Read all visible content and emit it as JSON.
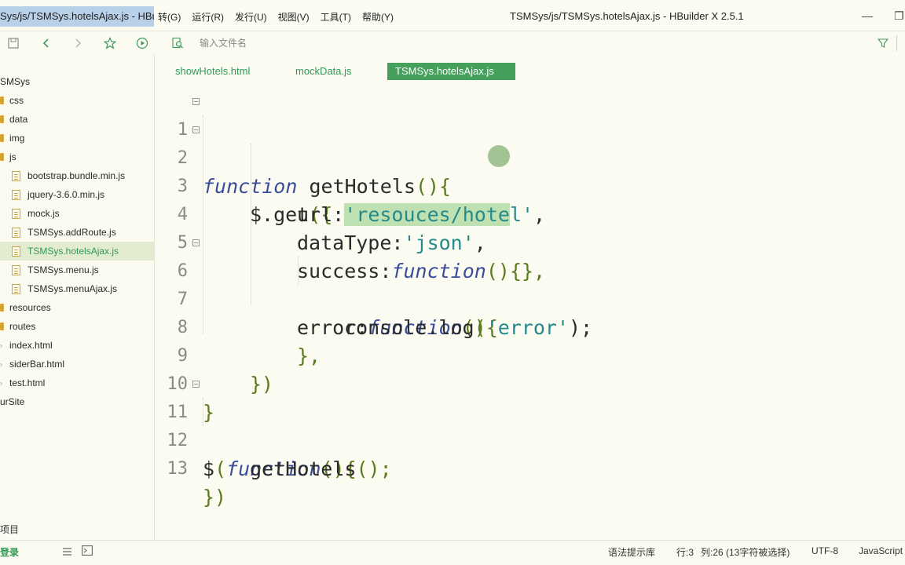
{
  "window": {
    "tab_title": "Sys/js/TSMSys.hotelsAjax.js - HBuil",
    "title": "TSMSys/js/TSMSys.hotelsAjax.js - HBuilder X 2.5.1",
    "minimize_glyph": "—",
    "restore_glyph": "❐"
  },
  "menu": [
    {
      "label": "转(G)"
    },
    {
      "label": "运行(R)"
    },
    {
      "label": "发行(U)"
    },
    {
      "label": "视图(V)"
    },
    {
      "label": "工具(T)"
    },
    {
      "label": "帮助(Y)"
    }
  ],
  "toolbar": {
    "search_placeholder": "输入文件名"
  },
  "sidebar": {
    "items": [
      {
        "label": "SMSys",
        "type": "root"
      },
      {
        "label": "css",
        "type": "folder"
      },
      {
        "label": "data",
        "type": "folder"
      },
      {
        "label": "img",
        "type": "folder"
      },
      {
        "label": "js",
        "type": "folder"
      },
      {
        "label": "bootstrap.bundle.min.js",
        "type": "file"
      },
      {
        "label": "jquery-3.6.0.min.js",
        "type": "file"
      },
      {
        "label": "mock.js",
        "type": "file"
      },
      {
        "label": "TSMSys.addRoute.js",
        "type": "file"
      },
      {
        "label": "TSMSys.hotelsAjax.js",
        "type": "file",
        "selected": true
      },
      {
        "label": "TSMSys.menu.js",
        "type": "file"
      },
      {
        "label": "TSMSys.menuAjax.js",
        "type": "file"
      },
      {
        "label": "resources",
        "type": "folder"
      },
      {
        "label": "routes",
        "type": "folder"
      },
      {
        "label": "index.html",
        "type": "html"
      },
      {
        "label": "siderBar.html",
        "type": "html"
      },
      {
        "label": "test.html",
        "type": "html"
      },
      {
        "label": "urSite",
        "type": "root"
      }
    ],
    "project_label": "项目"
  },
  "tabs": [
    {
      "label": "showHotels.html"
    },
    {
      "label": "mockData.js"
    },
    {
      "label": "TSMSys.hotelsAjax.js",
      "active": true
    }
  ],
  "code": {
    "lines": [
      {
        "n": "1",
        "fold": true
      },
      {
        "n": "2",
        "fold": true
      },
      {
        "n": "3"
      },
      {
        "n": "4"
      },
      {
        "n": "5"
      },
      {
        "n": "6",
        "fold": true
      },
      {
        "n": "7"
      },
      {
        "n": "8"
      },
      {
        "n": "9"
      },
      {
        "n": "10"
      },
      {
        "n": "11",
        "fold": true
      },
      {
        "n": "12"
      },
      {
        "n": "13"
      }
    ],
    "tokens": {
      "kw_function": "function",
      "get_hotels": " getHotels",
      "paren_open_brace": "(){",
      "jq_get": "$.get",
      "paren_brace_open": "({",
      "url_key": "url:",
      "url_sel": "'resouces/hote",
      "url_rest": "l'",
      "comma": ",",
      "datatype_key": "dataType:",
      "json_str": "'json'",
      "success_key": "success:",
      "empty_fn_tail": "(){},",
      "error_key": "error:",
      "console_log": "console.log",
      "error_str": "'error'",
      "log_tail": ");",
      "paren_open": "(",
      "close_brace_comma": "},",
      "close_brace_paren": "})",
      "close_brace": "}",
      "dollar": "$",
      "open_paren": "(",
      "call_get_hotels": "getHotels",
      "call_tail": "();"
    }
  },
  "status": {
    "login": "登录",
    "syntax_lib": "语法提示库",
    "line": "行:3",
    "column": "列:26 (13字符被选择)",
    "encoding": "UTF-8",
    "language": "JavaScript"
  }
}
